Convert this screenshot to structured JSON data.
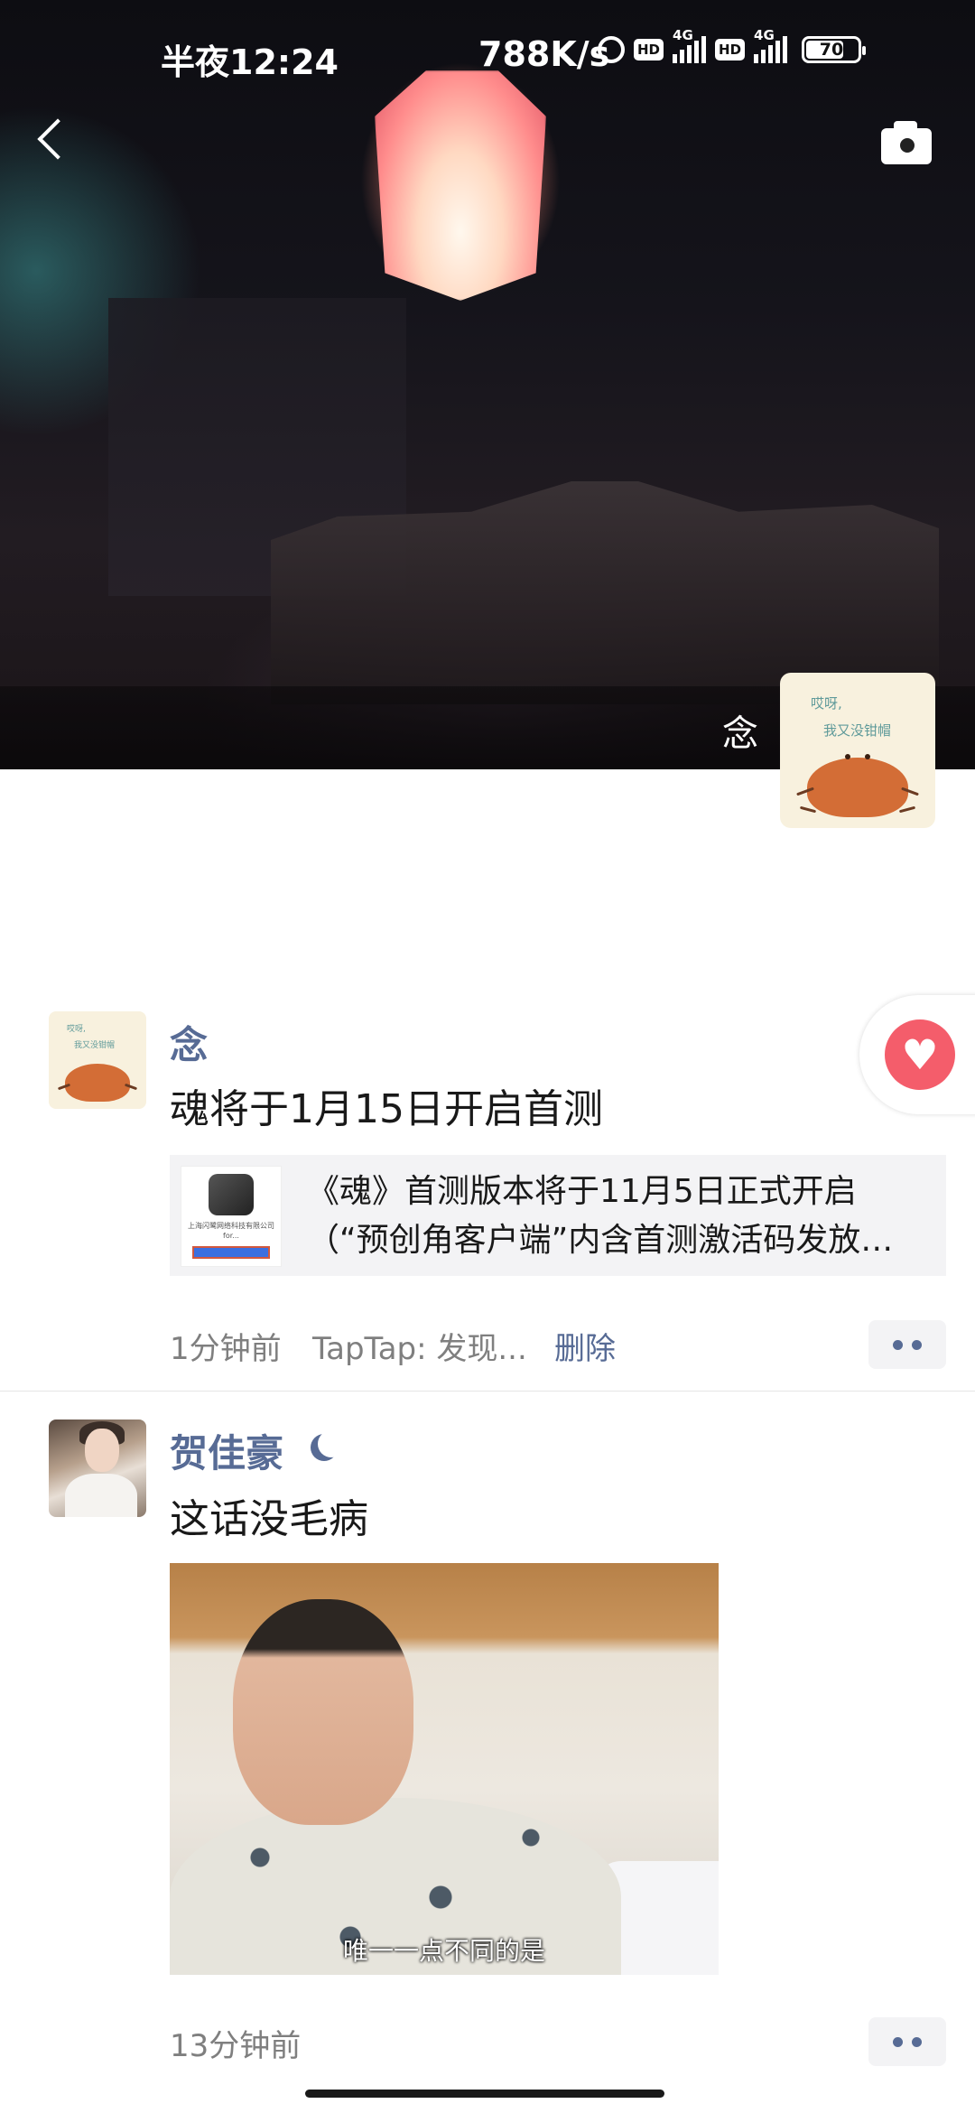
{
  "status_bar": {
    "time": "半夜12:24",
    "net_speed": "788K/s",
    "hd_label": "HD",
    "network_label": "4G",
    "battery": "70"
  },
  "cover": {
    "owner_name": "念",
    "avatar_text_line1": "哎呀,",
    "avatar_text_line2": "我又没钳帽"
  },
  "posts": [
    {
      "author": "念",
      "text": "魂将于1月15日开启首测",
      "link_card": {
        "title": "《魂》首测版本将于11月5日正式开启（“预创角客户端”内含首测激活码发放…",
        "thumb_caption": "上海闪鹭网络科技有限公司 for..."
      },
      "time": "1分钟前",
      "source": "TapTap: 发现...",
      "delete_label": "删除"
    },
    {
      "author": "贺佳豪",
      "text": "这话没毛病",
      "image_subtitle": "唯一一点不同的是",
      "time": "13分钟前"
    }
  ],
  "colors": {
    "link_blue": "#576b95",
    "like_red": "#f45d6b",
    "meta_gray": "#7f7f7f"
  }
}
